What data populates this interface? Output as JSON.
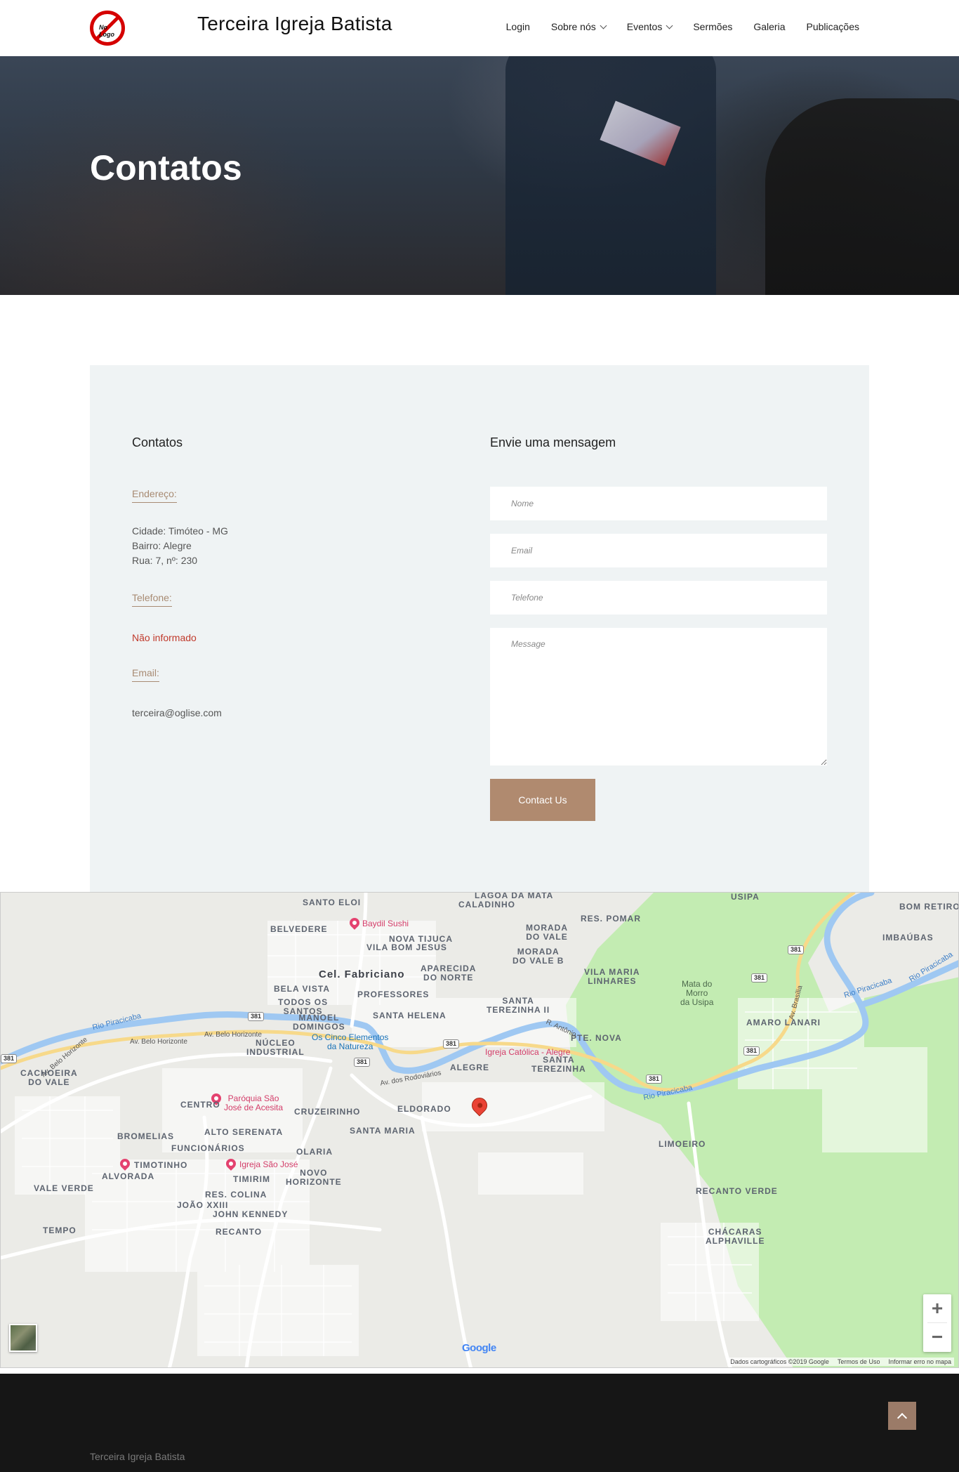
{
  "header": {
    "logo_text": "No Logo",
    "site_title": "Terceira Igreja Batista",
    "nav": [
      {
        "label": "Login",
        "has_dropdown": false
      },
      {
        "label": "Sobre nós",
        "has_dropdown": true
      },
      {
        "label": "Eventos",
        "has_dropdown": true
      },
      {
        "label": "Sermões",
        "has_dropdown": false
      },
      {
        "label": "Galeria",
        "has_dropdown": false
      },
      {
        "label": "Publicações",
        "has_dropdown": false
      }
    ]
  },
  "hero": {
    "title": "Contatos"
  },
  "contact": {
    "left_title": "Contatos",
    "address_label": "Endereço:",
    "address_lines": [
      "Cidade: Timóteo - MG",
      "Bairro: Alegre",
      "Rua: 7, nº: 230"
    ],
    "phone_label": "Telefone:",
    "phone_value": "Não informado",
    "email_label": "Email:",
    "email_value": "terceira@oglise.com",
    "right_title": "Envie uma mensagem",
    "form": {
      "name_placeholder": "Nome",
      "email_placeholder": "Email",
      "phone_placeholder": "Telefone",
      "message_placeholder": "Message",
      "submit_label": "Contact Us"
    }
  },
  "map": {
    "labels": {
      "santo_eloi": "SANTO ELOI",
      "lagoa": "LAGOA DA MATA",
      "caladinho": "CALADINHO",
      "usipa": "USIPA",
      "bom_retiro": "BOM RETIRO",
      "baydil": "Baydil Sushi",
      "belvedere": "BELVEDERE",
      "morada_vale": "MORADA\nDO VALE",
      "res_pomar": "RES. POMAR",
      "imbaubas": "IMBAÚBAS",
      "nova_tijuca": "NOVA TIJUCA",
      "vila_bom_jesus": "VILA BOM JESUS",
      "morada_vale_b": "MORADA\nDO VALE B",
      "cel_fabriciano": "Cel. Fabriciano",
      "aparecida": "APARECIDA\nDO NORTE",
      "vila_maria": "VILA MARIA\nLINHARES",
      "mata_usipa": "Mata do\nMorro\nda Usipa",
      "bela_vista": "BELA VISTA",
      "professores": "PROFESSORES",
      "todos_santos": "TODOS OS\nSANTOS",
      "santa_terezinha_ii": "SANTA\nTEREZINHA II",
      "manoel_domingos": "MANOEL\nDOMINGOS",
      "santa_helena": "SANTA HELENA",
      "amaro_lanari": "AMARO LANARI",
      "rio_piracicaba": "Rio Piracicaba",
      "av_bh_1": "Av. Belo Horizonte",
      "av_bh_2": "Av. Belo Horizonte",
      "av_bh_3": "Av. Belo Horizonte",
      "nucleo": "NÚCLEO\nINDUSTRIAL",
      "cinco_elementos": "Os Cinco Elementos\nda Natureza",
      "pte_nova": "PTE. NOVA",
      "igreja_catolica": "Igreja Católica - Alegre",
      "alegre": "ALEGRE",
      "santa_terezinha": "SANTA\nTEREZINHA",
      "cachoeira": "CACHOEIRA\nDO VALE",
      "av_rodoviarios": "Av. dos Rodoviários",
      "paroquia": "Paróquia São\nJosé de Acesita",
      "centro": "CENTRO",
      "cruzeirinho": "CRUZEIRINHO",
      "eldorado": "ELDORADO",
      "bromelias": "BROMELIAS",
      "alto_serenata": "ALTO SERENATA",
      "santa_maria": "SANTA MARIA",
      "limoeiro": "LIMOEIRO",
      "funcionarios": "FUNCIONÁRIOS",
      "olaria": "OLARIA",
      "timotinho": "TIMOTINHO",
      "igreja_sao_jose": "Igreja São José",
      "alvorada": "ALVORADA",
      "timirim": "TIMIRIM",
      "novo_horizonte": "NOVO\nHORIZONTE",
      "vale_verde": "VALE VERDE",
      "recanto_verde": "RECANTO VERDE",
      "res_colina": "RES. COLINA",
      "joao_xxiii": "JOÃO XXIII",
      "john_kennedy": "JOHN KENNEDY",
      "tempo": "TEMPO",
      "recanto": "RECANTO",
      "chacaras": "CHÁCARAS\nALPHAVILLE",
      "r_antonio": "R. Antônio",
      "av_brasilia": "Av. Brasília"
    },
    "shields": [
      "381",
      "381",
      "381",
      "381",
      "381",
      "381",
      "381",
      "381"
    ],
    "footer_data": "Dados cartográficos ©2019 Google",
    "footer_terms": "Termos de Uso",
    "footer_report": "Informar erro no mapa",
    "google": "Google",
    "zoom_in": "+",
    "zoom_out": "−"
  },
  "footer": {
    "copyright": "Terceira Igreja Batista"
  },
  "colors": {
    "accent": "#b08a6f",
    "label": "#a88b73",
    "phone_text": "#c0392b",
    "contact_bg": "#eff3f4",
    "footer_bg": "#161616"
  }
}
